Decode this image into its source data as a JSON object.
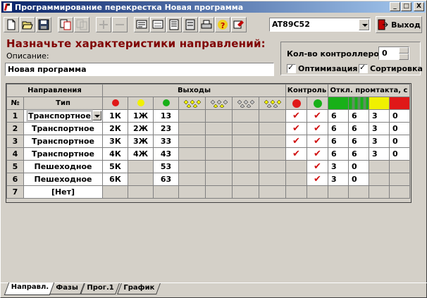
{
  "window": {
    "title": "Программирование перекрестка Новая программа",
    "min_label": "_",
    "max_label": "□",
    "close_label": "X"
  },
  "toolbar": {
    "icons": [
      "new-icon",
      "open-icon",
      "save-icon",
      "copy-icon",
      "paste-icon",
      "add-icon",
      "remove-icon",
      "tool1-icon",
      "tool2-icon",
      "tool3-icon",
      "tool4-icon",
      "print-icon",
      "help-icon",
      "settings-icon"
    ],
    "controller_model": "AT89C52",
    "exit_label": "Выход"
  },
  "heading": "Назначьте характеристики направлений:",
  "description": {
    "label": "Описание:",
    "value": "Новая программа"
  },
  "controllers": {
    "label": "Кол-во контроллеров",
    "value": "0",
    "optimization_label": "Оптимизация",
    "optimization_checked": true,
    "sorting_label": "Сортировка",
    "sorting_checked": true
  },
  "grid": {
    "headers": {
      "directions": "Направления",
      "outputs": "Выходы",
      "control": "Контроль",
      "offset": "Откл. промтакта, с",
      "num": "№",
      "type": "Тип"
    },
    "colors": {
      "red": "#e01818",
      "yellow": "#f0f000",
      "green": "#18b018",
      "gray_green": "#609060"
    },
    "rows": [
      {
        "n": "1",
        "type": "Транспортное",
        "o1": "1К",
        "o2": "1Ж",
        "o3": "13",
        "c1": true,
        "c2": true,
        "t": [
          "6",
          "6",
          "3",
          "0"
        ]
      },
      {
        "n": "2",
        "type": "Транспортное",
        "o1": "2К",
        "o2": "2Ж",
        "o3": "23",
        "c1": true,
        "c2": true,
        "t": [
          "6",
          "6",
          "3",
          "0"
        ]
      },
      {
        "n": "3",
        "type": "Транспортное",
        "o1": "3К",
        "o2": "3Ж",
        "o3": "33",
        "c1": true,
        "c2": true,
        "t": [
          "6",
          "6",
          "3",
          "0"
        ]
      },
      {
        "n": "4",
        "type": "Транспортное",
        "o1": "4К",
        "o2": "4Ж",
        "o3": "43",
        "c1": true,
        "c2": true,
        "t": [
          "6",
          "6",
          "3",
          "0"
        ]
      },
      {
        "n": "5",
        "type": "Пешеходное",
        "o1": "5К",
        "o2": "",
        "o3": "53",
        "c1": false,
        "c2": true,
        "t": [
          "3",
          "0",
          "",
          ""
        ]
      },
      {
        "n": "6",
        "type": "Пешеходное",
        "o1": "6К",
        "o2": "",
        "o3": "63",
        "c1": false,
        "c2": true,
        "t": [
          "3",
          "0",
          "",
          ""
        ]
      },
      {
        "n": "7",
        "type": "[Нет]",
        "o1": "",
        "o2": "",
        "o3": "",
        "c1": false,
        "c2": false,
        "t": [
          "",
          "",
          "",
          ""
        ]
      }
    ]
  },
  "tabs": [
    "Направл.",
    "Фазы",
    "Прог.1",
    "График"
  ]
}
